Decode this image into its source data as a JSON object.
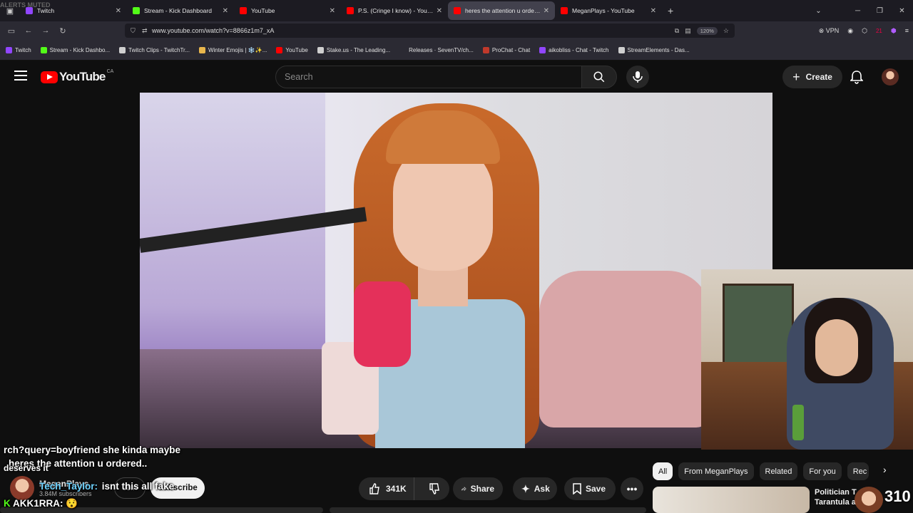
{
  "browser": {
    "alerts_label": "ALERTS MUTED",
    "tabs": [
      {
        "title": "Twitch",
        "color": "#9146ff"
      },
      {
        "title": "Stream - Kick Dashboard",
        "color": "#53fc18"
      },
      {
        "title": "YouTube",
        "color": "#ff0000"
      },
      {
        "title": "P.S. (Cringe I know) - YouTube",
        "color": "#ff0000"
      },
      {
        "title": "heres the attention u ordered..",
        "color": "#ff0000"
      },
      {
        "title": "MeganPlays - YouTube",
        "color": "#ff0000"
      }
    ],
    "url": "www.youtube.com/watch?v=8866z1m7_xA",
    "zoom": "120%",
    "vpn_label": "VPN",
    "extension_badge": "21",
    "bookmarks": [
      {
        "label": "Twitch",
        "color": "#9146ff"
      },
      {
        "label": "Stream - Kick Dashbo...",
        "color": "#53fc18"
      },
      {
        "label": "Twitch Clips - TwitchTr...",
        "color": "#cfcfcf"
      },
      {
        "label": "Winter Emojis | ❄️✨...",
        "color": "#e8b64c"
      },
      {
        "label": "YouTube",
        "color": "#ff0000"
      },
      {
        "label": "Stake.us - The Leading...",
        "color": "#cfcfcf"
      },
      {
        "label": "Releases · SevenTV/ch...",
        "color": "#2b2a33"
      },
      {
        "label": "ProChat - Chat",
        "color": "#c0392b"
      },
      {
        "label": "aikobliss - Chat - Twitch",
        "color": "#9146ff"
      },
      {
        "label": "StreamElements - Das...",
        "color": "#cfcfcf"
      }
    ]
  },
  "youtube": {
    "logo_text": "YouTube",
    "country": "CA",
    "search_placeholder": "Search",
    "create_label": "Create"
  },
  "overlay_chat": {
    "line1": "rch?query=boyfriend she kinda maybe",
    "line2": "heres the attention u ordered..",
    "line3": "deserves it",
    "line4_user": "Tech_Taylor:",
    "line4_msg": "isnt this all fake",
    "line5": "AKK1RRA:"
  },
  "channel": {
    "name": "MeganPlays",
    "subscribers": "3.84M subscribers",
    "join_label": "Join",
    "subscribe_label": "Subscribe"
  },
  "actions": {
    "likes": "341K",
    "share_label": "Share",
    "ask_label": "Ask",
    "save_label": "Save"
  },
  "chips": [
    "All",
    "From MeganPlays",
    "Related",
    "For you",
    "Rec"
  ],
  "recommendation": {
    "title_line1": "Politician T",
    "title_line2": "Tarantula a",
    "overlay_number": "310"
  }
}
